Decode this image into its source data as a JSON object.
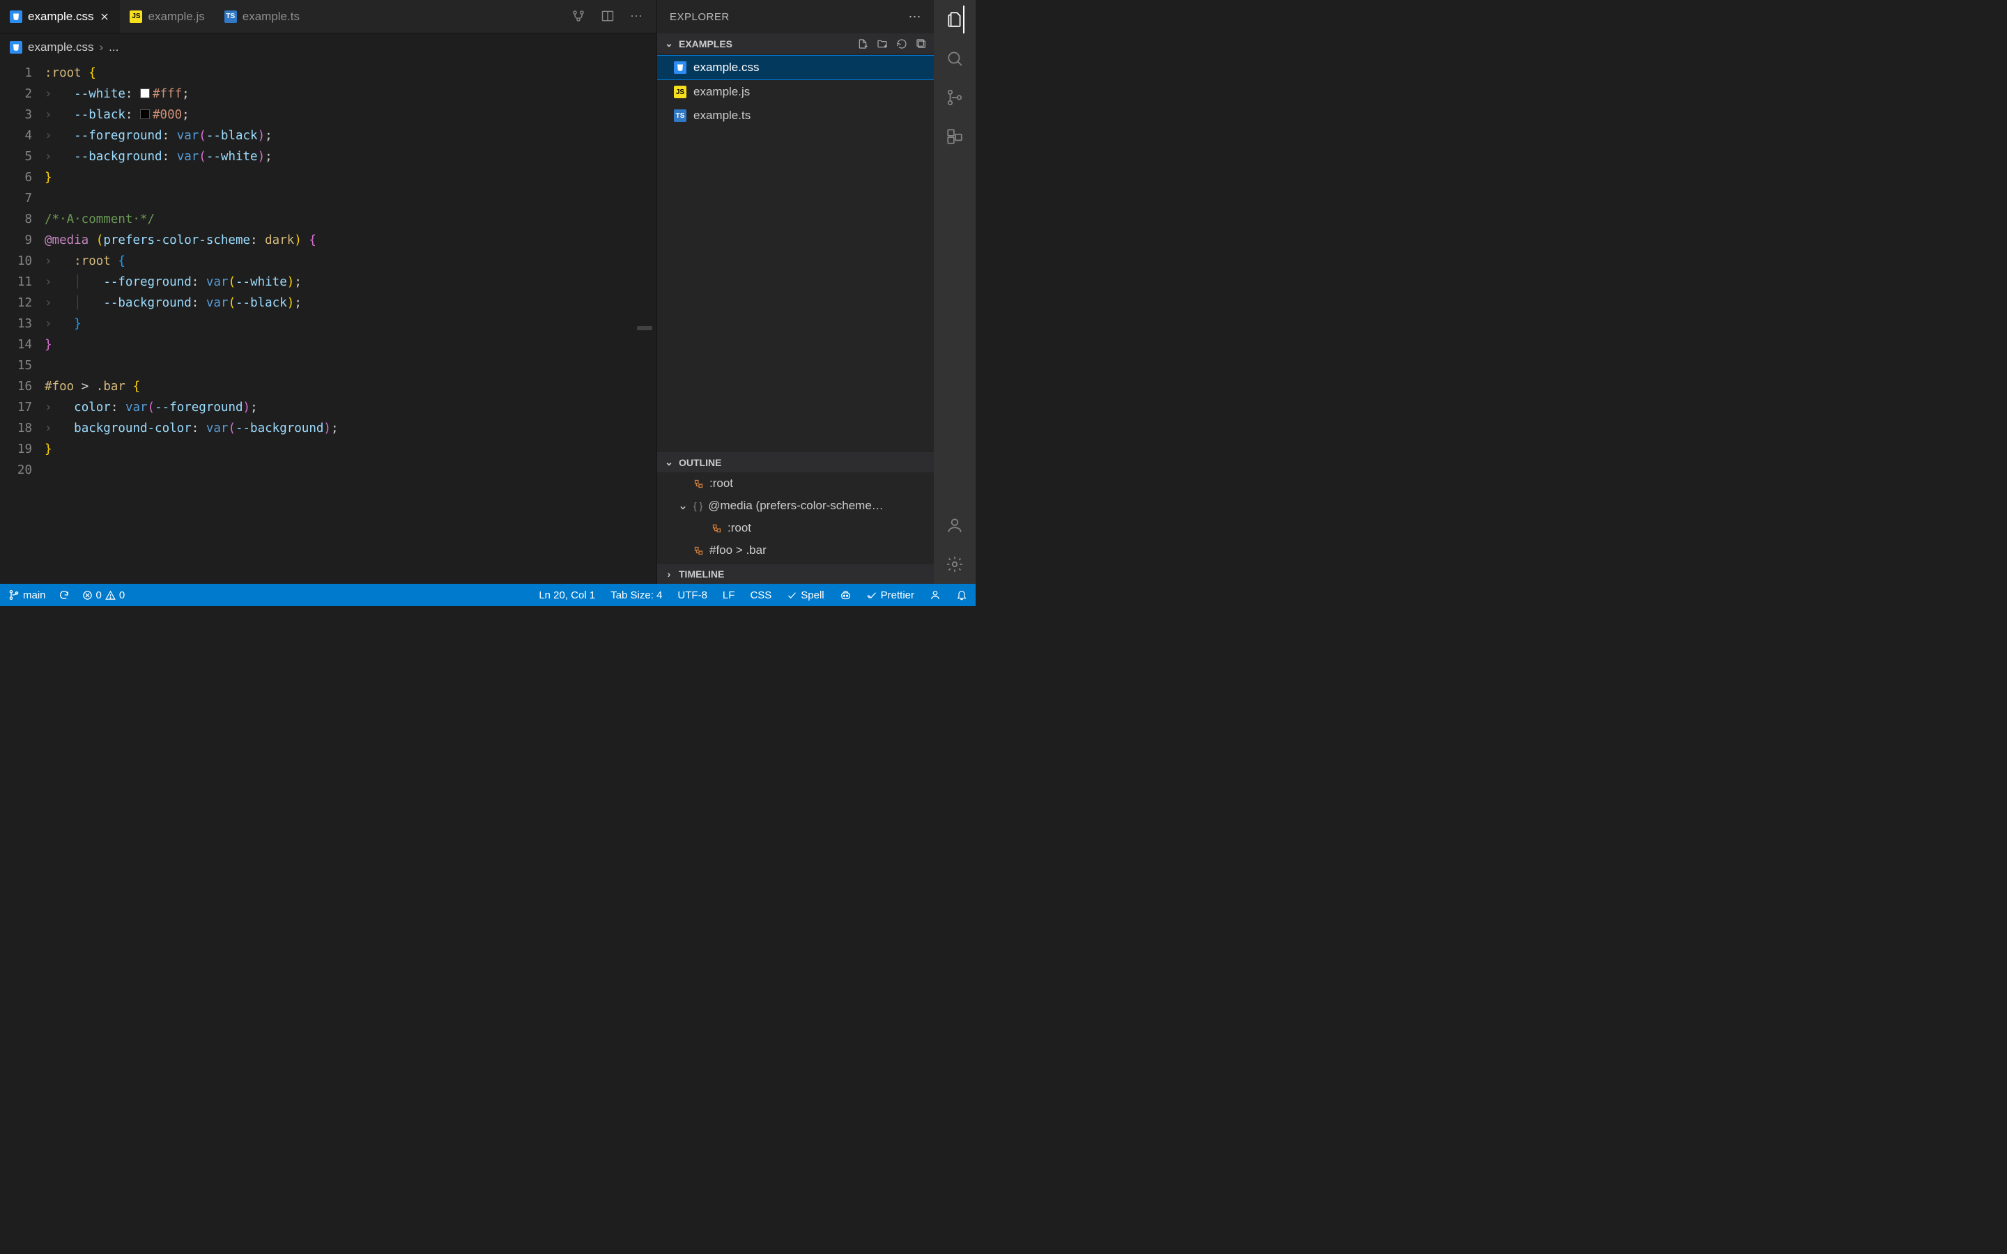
{
  "tabs": [
    {
      "label": "example.css",
      "icon": "css",
      "active": true
    },
    {
      "label": "example.js",
      "icon": "js",
      "active": false
    },
    {
      "label": "example.ts",
      "icon": "ts",
      "active": false
    }
  ],
  "breadcrumb": {
    "file": "example.css",
    "rest": "..."
  },
  "code_lines": [
    {
      "n": 1,
      "html": "<span class='tok-sel'>:root</span> <span class='tok-brace'>{</span>"
    },
    {
      "n": 2,
      "html": "<span class='indent-arrow'>›   </span><span class='tok-prop'>--white</span><span class='tok-punc'>:</span> <span class='color-swatch' style='background:#fff'></span><span class='tok-color'>#fff</span><span class='tok-punc'>;</span>"
    },
    {
      "n": 3,
      "html": "<span class='indent-arrow'>›   </span><span class='tok-prop'>--black</span><span class='tok-punc'>:</span> <span class='color-swatch' style='background:#000'></span><span class='tok-color'>#000</span><span class='tok-punc'>;</span>"
    },
    {
      "n": 4,
      "html": "<span class='indent-arrow'>›   </span><span class='tok-prop'>--foreground</span><span class='tok-punc'>:</span> <span class='tok-fn'>var</span><span class='tok-brace-p'>(</span><span class='tok-var'>--black</span><span class='tok-brace-p'>)</span><span class='tok-punc'>;</span>"
    },
    {
      "n": 5,
      "html": "<span class='indent-arrow'>›   </span><span class='tok-prop'>--background</span><span class='tok-punc'>:</span> <span class='tok-fn'>var</span><span class='tok-brace-p'>(</span><span class='tok-var'>--white</span><span class='tok-brace-p'>)</span><span class='tok-punc'>;</span>"
    },
    {
      "n": 6,
      "html": "<span class='tok-brace'>}</span>"
    },
    {
      "n": 7,
      "html": ""
    },
    {
      "n": 8,
      "html": "<span class='tok-com'>/*·A·comment·*/</span>"
    },
    {
      "n": 9,
      "html": "<span class='tok-kw'>@media</span> <span class='tok-brace'>(</span><span class='tok-prop'>prefers-color-scheme</span><span class='tok-punc'>:</span> <span class='tok-sel'>dark</span><span class='tok-brace'>)</span> <span class='tok-brace-p'>{</span>"
    },
    {
      "n": 10,
      "html": "<span class='indent-arrow'>›   </span><span class='tok-sel'>:root</span> <span class='tok-brace-b'>{</span>"
    },
    {
      "n": 11,
      "html": "<span class='indent-arrow'>›   </span><span class='indent-guide'>│   </span><span class='tok-prop'>--foreground</span><span class='tok-punc'>:</span> <span class='tok-fn'>var</span><span class='tok-brace'>(</span><span class='tok-var'>--white</span><span class='tok-brace'>)</span><span class='tok-punc'>;</span>"
    },
    {
      "n": 12,
      "html": "<span class='indent-arrow'>›   </span><span class='indent-guide'>│   </span><span class='tok-prop'>--background</span><span class='tok-punc'>:</span> <span class='tok-fn'>var</span><span class='tok-brace'>(</span><span class='tok-var'>--black</span><span class='tok-brace'>)</span><span class='tok-punc'>;</span>"
    },
    {
      "n": 13,
      "html": "<span class='indent-arrow'>›   </span><span class='tok-brace-b'>}</span>"
    },
    {
      "n": 14,
      "html": "<span class='tok-brace-p'>}</span>"
    },
    {
      "n": 15,
      "html": ""
    },
    {
      "n": 16,
      "html": "<span class='tok-sel'>#foo</span> <span class='tok-punc'>&gt;</span> <span class='tok-sel'>.bar</span> <span class='tok-brace'>{</span>"
    },
    {
      "n": 17,
      "html": "<span class='indent-arrow'>›   </span><span class='tok-prop'>color</span><span class='tok-punc'>:</span> <span class='tok-fn'>var</span><span class='tok-brace-p'>(</span><span class='tok-var'>--foreground</span><span class='tok-brace-p'>)</span><span class='tok-punc'>;</span>"
    },
    {
      "n": 18,
      "html": "<span class='indent-arrow'>›   </span><span class='tok-prop'>background-color</span><span class='tok-punc'>:</span> <span class='tok-fn'>var</span><span class='tok-brace-p'>(</span><span class='tok-var'>--background</span><span class='tok-brace-p'>)</span><span class='tok-punc'>;</span>"
    },
    {
      "n": 19,
      "html": "<span class='tok-brace'>}</span>"
    },
    {
      "n": 20,
      "html": ""
    }
  ],
  "sidebar": {
    "title": "EXPLORER",
    "section": "EXAMPLES",
    "files": [
      {
        "label": "example.css",
        "icon": "css",
        "selected": true
      },
      {
        "label": "example.js",
        "icon": "js",
        "selected": false
      },
      {
        "label": "example.ts",
        "icon": "ts",
        "selected": false
      }
    ],
    "outline_title": "OUTLINE",
    "outline": [
      {
        "label": ":root",
        "nested": false,
        "kind": "selector",
        "twisty": ""
      },
      {
        "label": "@media (prefers-color-scheme…",
        "nested": false,
        "kind": "braces",
        "twisty": "⌄"
      },
      {
        "label": ":root",
        "nested": true,
        "kind": "selector",
        "twisty": ""
      },
      {
        "label": "#foo > .bar",
        "nested": false,
        "kind": "selector",
        "twisty": ""
      }
    ],
    "timeline_title": "TIMELINE"
  },
  "status": {
    "branch": "main",
    "errors": "0",
    "warnings": "0",
    "position": "Ln 20, Col 1",
    "tabsize": "Tab Size: 4",
    "encoding": "UTF-8",
    "eol": "LF",
    "language": "CSS",
    "spell": "Spell",
    "prettier": "Prettier"
  }
}
